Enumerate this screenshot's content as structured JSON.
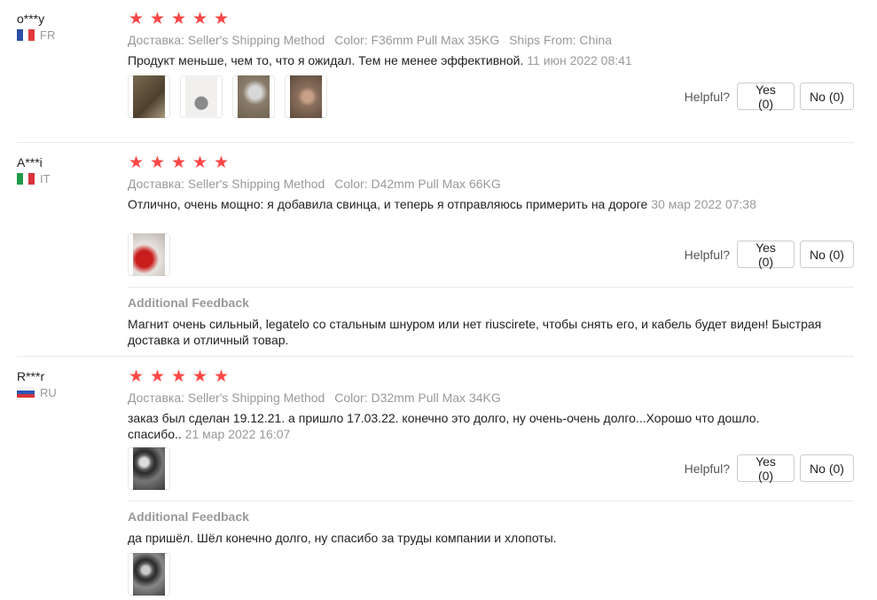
{
  "helpful_label": "Helpful?",
  "reviews": [
    {
      "user": "o***y",
      "country": "FR",
      "stars": 5,
      "shipping": "Доставка: Seller's Shipping Method",
      "color": "Color: F36mm Pull Max 35KG",
      "ships_from": "Ships From: China",
      "text": "Продукт меньше, чем то, что я ожидал. Тем не менее эффективной.",
      "date": "11 июн 2022 08:41",
      "yes": "Yes (0)",
      "no": "No (0)"
    },
    {
      "user": "A***i",
      "country": "IT",
      "stars": 5,
      "shipping": "Доставка: Seller's Shipping Method",
      "color": "Color: D42mm Pull Max 66KG",
      "text": "Отлично, очень мощно: я добавила свинца, и теперь я отправляюсь примерить на дороге",
      "date": "30 мар 2022 07:38",
      "yes": "Yes (0)",
      "no": "No (0)",
      "additional_title": "Additional Feedback",
      "additional_text": "Магнит очень сильный, legatelo со стальным шнуром или нет riuscirete, чтобы снять его, и кабель будет виден! Быстрая доставка и отличный товар."
    },
    {
      "user": "R***r",
      "country": "RU",
      "stars": 5,
      "shipping": "Доставка: Seller's Shipping Method",
      "color": "Color: D32mm Pull Max 34KG",
      "text": "заказ был сделан 19.12.21. а пришло 17.03.22. конечно это долго, ну очень-очень долго...Хорошо что дошло. спасибо..",
      "date": "21 мар 2022 16:07",
      "yes": "Yes (0)",
      "no": "No (0)",
      "additional_title": "Additional Feedback",
      "additional_text": "да пришёл. Шёл конечно долго, ну спасибо за труды компании и хлопоты."
    }
  ],
  "colors": {
    "star": "#ff4747",
    "muted": "#999999",
    "divider": "#e8e8e8"
  }
}
